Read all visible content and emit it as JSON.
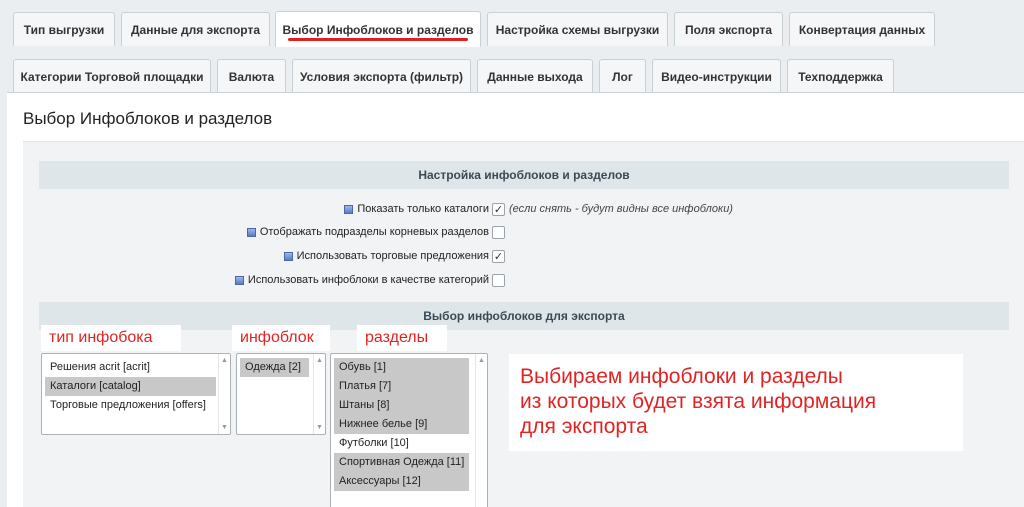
{
  "tabs_row1": [
    {
      "label": "Тип выгрузки"
    },
    {
      "label": "Данные для экспорта"
    },
    {
      "label": "Выбор Инфоблоков и разделов"
    },
    {
      "label": "Настройка схемы выгрузки"
    },
    {
      "label": "Поля экспорта"
    },
    {
      "label": "Конвертация данных"
    }
  ],
  "tabs_row2": [
    {
      "label": "Категории Торговой площадки"
    },
    {
      "label": "Валюта"
    },
    {
      "label": "Условия экспорта (фильтр)"
    },
    {
      "label": "Данные выхода"
    },
    {
      "label": "Лог"
    },
    {
      "label": "Видео-инструкции"
    },
    {
      "label": "Техподдержка"
    }
  ],
  "active_tab": "Выбор Инфоблоков и разделов",
  "page_title": "Выбор Инфоблоков и разделов",
  "section1": {
    "title": "Настройка инфоблоков и разделов",
    "options": [
      {
        "label": "Показать только каталоги",
        "checked": true,
        "hint": "(если снять - будут видны все инфоблоки)"
      },
      {
        "label": "Отображать подразделы корневых разделов",
        "checked": false
      },
      {
        "label": "Использовать торговые предложения",
        "checked": true
      },
      {
        "label": "Использовать инфоблоки в качестве категорий",
        "checked": false
      }
    ]
  },
  "section2": {
    "title": "Выбор инфоблоков для экспорта",
    "annotations": {
      "type": "тип инфобока",
      "iblock": "инфоблок",
      "sections": "разделы"
    },
    "iblock_types": [
      {
        "label": "Решения acrit [acrit]",
        "selected": false
      },
      {
        "label": "Каталоги [catalog]",
        "selected": true
      },
      {
        "label": "Торговые предложения [offers]",
        "selected": false
      }
    ],
    "iblocks": [
      {
        "label": "Одежда [2]",
        "selected": true
      }
    ],
    "sections_list": [
      {
        "label": "Обувь [1]",
        "selected": true
      },
      {
        "label": "Платья [7]",
        "selected": true
      },
      {
        "label": "Штаны [8]",
        "selected": true
      },
      {
        "label": "Нижнее белье [9]",
        "selected": true
      },
      {
        "label": "Футболки [10]",
        "selected": false
      },
      {
        "label": "Спортивная Одежда [11]",
        "selected": true
      },
      {
        "label": "Аксессуары [12]",
        "selected": true
      }
    ]
  },
  "callout": {
    "line1": "Выбираем инфоблоки и разделы",
    "line2": "из которых будет взята информация",
    "line3": "для экспорта"
  },
  "colors": {
    "accent_red": "#e02424",
    "selected_bg": "#c8c8c8",
    "section_header_bg": "#dfe6ea"
  },
  "icons": {
    "help": "help-icon",
    "check": "✓",
    "scroll_up": "▲",
    "scroll_down": "▼"
  }
}
